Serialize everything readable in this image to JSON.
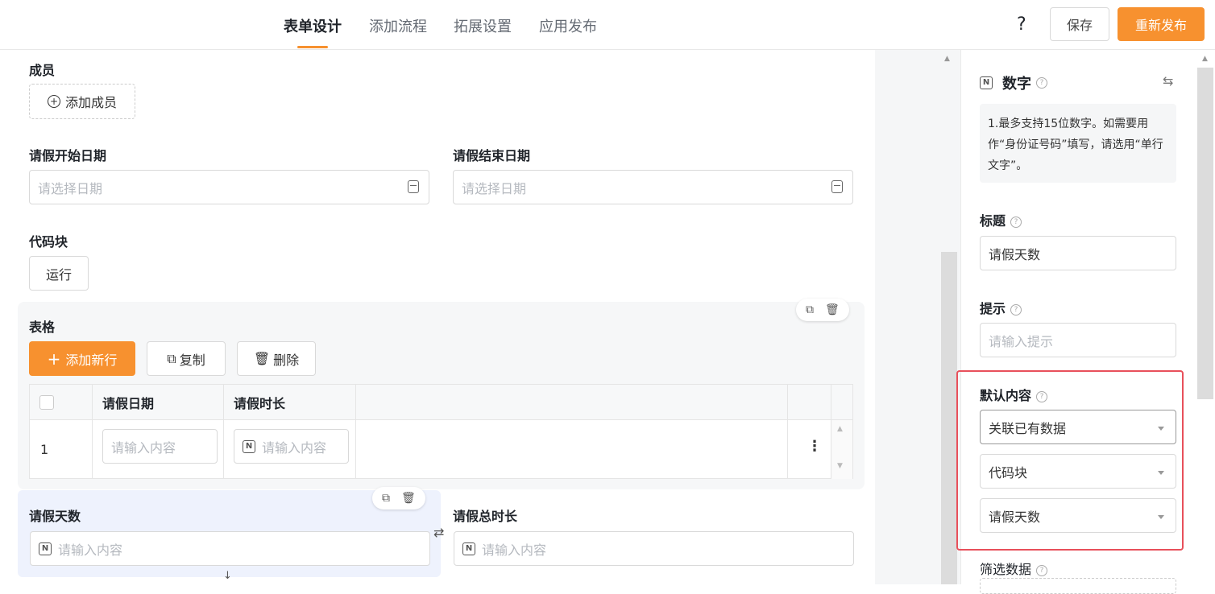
{
  "topbar": {
    "tabs": [
      "表单设计",
      "添加流程",
      "拓展设置",
      "应用发布"
    ],
    "help": "?",
    "save_label": "保存",
    "publish_label": "重新发布"
  },
  "form": {
    "members_label": "成员",
    "add_member": "添加成员",
    "start_date_label": "请假开始日期",
    "start_date_placeholder": "请选择日期",
    "end_date_label": "请假结束日期",
    "end_date_placeholder": "请选择日期",
    "code_block_label": "代码块",
    "run_button": "运行",
    "table_label": "表格",
    "add_row": "添加新行",
    "copy": "复制",
    "delete": "删除",
    "table_columns": [
      "请假日期",
      "请假时长"
    ],
    "table_rows": [
      {
        "index": "1",
        "date_placeholder": "请输入内容",
        "duration_placeholder": "请输入内容"
      }
    ],
    "leave_days_label": "请假天数",
    "leave_days_placeholder": "请输入内容",
    "total_hours_label": "请假总时长",
    "total_hours_placeholder": "请输入内容"
  },
  "panel": {
    "field_type": "数字",
    "info_text": "1.最多支持15位数字。如需要用作“身份证号码”填写，请选用“单行文字”。",
    "title_label": "标题",
    "title_value": "请假天数",
    "hint_label": "提示",
    "hint_placeholder": "请输入提示",
    "default_label": "默认内容",
    "default_selects": [
      "关联已有数据",
      "代码块",
      "请假天数"
    ],
    "filter_label": "筛选数据"
  },
  "colors": {
    "accent": "#f7912f",
    "highlight": "#e8505b",
    "selected_bg": "#eef2fd"
  }
}
